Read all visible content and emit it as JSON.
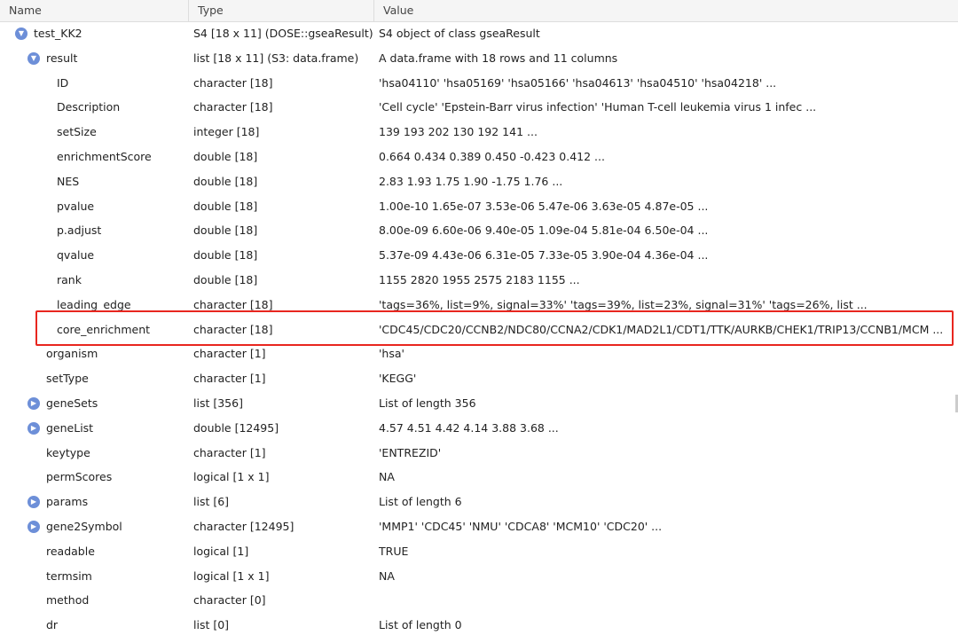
{
  "headers": {
    "name": "Name",
    "type": "Type",
    "value": "Value"
  },
  "rows": [
    {
      "name": "test_KK2",
      "type": "S4 [18 x 11] (DOSE::gseaResult)",
      "value": "S4 object of class gseaResult",
      "level": 0,
      "toggle": "expanded"
    },
    {
      "name": "result",
      "type": "list [18 x 11] (S3: data.frame)",
      "value": "A data.frame with 18 rows and 11 columns",
      "level": 1,
      "toggle": "expanded"
    },
    {
      "name": "ID",
      "type": "character [18]",
      "value": "'hsa04110' 'hsa05169' 'hsa05166' 'hsa04613' 'hsa04510' 'hsa04218' ...",
      "level": 2
    },
    {
      "name": "Description",
      "type": "character [18]",
      "value": "'Cell cycle' 'Epstein-Barr virus infection' 'Human T-cell leukemia virus 1 infec ...",
      "level": 2
    },
    {
      "name": "setSize",
      "type": "integer [18]",
      "value": "139 193 202 130 192 141 ...",
      "level": 2
    },
    {
      "name": "enrichmentScore",
      "type": "double [18]",
      "value": "0.664 0.434 0.389 0.450 -0.423 0.412 ...",
      "level": 2
    },
    {
      "name": "NES",
      "type": "double [18]",
      "value": "2.83 1.93 1.75 1.90 -1.75 1.76 ...",
      "level": 2
    },
    {
      "name": "pvalue",
      "type": "double [18]",
      "value": "1.00e-10 1.65e-07 3.53e-06 5.47e-06 3.63e-05 4.87e-05 ...",
      "level": 2
    },
    {
      "name": "p.adjust",
      "type": "double [18]",
      "value": "8.00e-09 6.60e-06 9.40e-05 1.09e-04 5.81e-04 6.50e-04 ...",
      "level": 2
    },
    {
      "name": "qvalue",
      "type": "double [18]",
      "value": "5.37e-09 4.43e-06 6.31e-05 7.33e-05 3.90e-04 4.36e-04 ...",
      "level": 2
    },
    {
      "name": "rank",
      "type": "double [18]",
      "value": "1155 2820 1955 2575 2183 1155 ...",
      "level": 2
    },
    {
      "name": "leading_edge",
      "type": "character [18]",
      "value": "'tags=36%, list=9%, signal=33%' 'tags=39%, list=23%, signal=31%' 'tags=26%, list ...",
      "level": 2
    },
    {
      "name": "core_enrichment",
      "type": "character [18]",
      "value": "'CDC45/CDC20/CCNB2/NDC80/CCNA2/CDK1/MAD2L1/CDT1/TTK/AURKB/CHEK1/TRIP13/CCNB1/MCM ...",
      "level": 2,
      "highlighted": true
    },
    {
      "name": "organism",
      "type": "character [1]",
      "value": "'hsa'",
      "level": 1
    },
    {
      "name": "setType",
      "type": "character [1]",
      "value": "'KEGG'",
      "level": 1
    },
    {
      "name": "geneSets",
      "type": "list [356]",
      "value": "List of length 356",
      "level": 1,
      "toggle": "collapsed"
    },
    {
      "name": "geneList",
      "type": "double [12495]",
      "value": "4.57 4.51 4.42 4.14 3.88 3.68 ...",
      "level": 1,
      "toggle": "collapsed"
    },
    {
      "name": "keytype",
      "type": "character [1]",
      "value": "'ENTREZID'",
      "level": 1
    },
    {
      "name": "permScores",
      "type": "logical [1 x 1]",
      "value": "NA",
      "level": 1
    },
    {
      "name": "params",
      "type": "list [6]",
      "value": "List of length 6",
      "level": 1,
      "toggle": "collapsed"
    },
    {
      "name": "gene2Symbol",
      "type": "character [12495]",
      "value": "'MMP1' 'CDC45' 'NMU' 'CDCA8' 'MCM10' 'CDC20' ...",
      "level": 1,
      "toggle": "collapsed"
    },
    {
      "name": "readable",
      "type": "logical [1]",
      "value": "TRUE",
      "level": 1
    },
    {
      "name": "termsim",
      "type": "logical [1 x 1]",
      "value": "NA",
      "level": 1
    },
    {
      "name": "method",
      "type": "character [0]",
      "value": "",
      "level": 1
    },
    {
      "name": "dr",
      "type": "list [0]",
      "value": "List of length 0",
      "level": 1
    }
  ],
  "colors": {
    "toggle": "#6d8fd8",
    "highlight": "#e8261f"
  }
}
